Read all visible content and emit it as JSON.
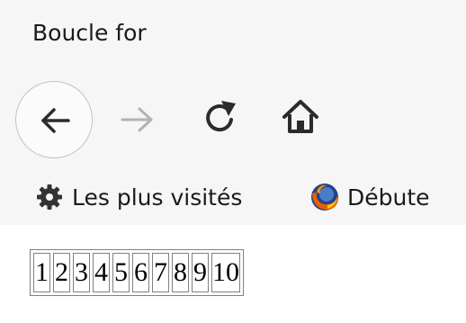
{
  "window": {
    "title": "Boucle for"
  },
  "toolbar": {
    "back_icon": "arrow-left-icon",
    "forward_icon": "arrow-right-icon",
    "reload_icon": "reload-icon",
    "home_icon": "home-icon",
    "enabled_color": "#2b2b2b",
    "disabled_color": "#b3b3b3"
  },
  "bookmarks": {
    "items": [
      {
        "label": "Les plus visités",
        "icon": "gear-icon"
      },
      {
        "label": "Débute",
        "icon": "firefox-logo-icon"
      }
    ]
  },
  "content": {
    "table": {
      "cells": [
        "1",
        "2",
        "3",
        "4",
        "5",
        "6",
        "7",
        "8",
        "9",
        "10"
      ]
    }
  }
}
